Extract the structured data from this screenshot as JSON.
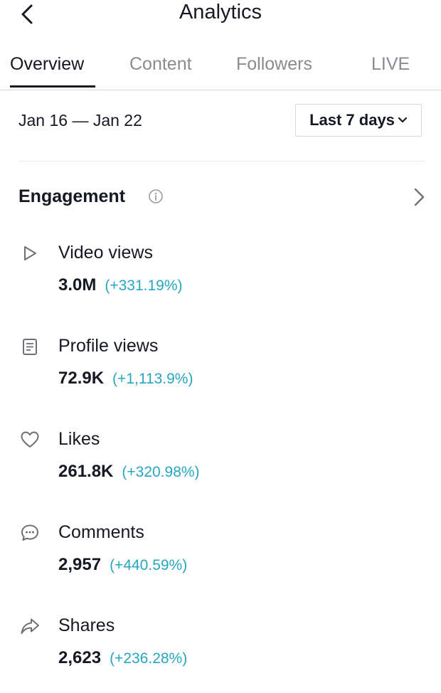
{
  "header": {
    "title": "Analytics"
  },
  "tabs": [
    {
      "label": "Overview",
      "active": true
    },
    {
      "label": "Content"
    },
    {
      "label": "Followers"
    },
    {
      "label": "LIVE"
    }
  ],
  "date_range": "Jan 16 — Jan 22",
  "range_select": {
    "label": "Last 7 days"
  },
  "section": {
    "title": "Engagement"
  },
  "metrics": [
    {
      "label": "Video views",
      "value": "3.0M",
      "change": "(+331.19%)",
      "icon": "play-icon"
    },
    {
      "label": "Profile views",
      "value": "72.9K",
      "change": "(+1,113.9%)",
      "icon": "profile-doc-icon"
    },
    {
      "label": "Likes",
      "value": "261.8K",
      "change": "(+320.98%)",
      "icon": "heart-icon"
    },
    {
      "label": "Comments",
      "value": "2,957",
      "change": "(+440.59%)",
      "icon": "comment-icon"
    },
    {
      "label": "Shares",
      "value": "2,623",
      "change": "(+236.28%)",
      "icon": "share-icon"
    }
  ],
  "colors": {
    "accent_change": "#27a6c0",
    "text": "#161823",
    "muted": "#8a8b91"
  }
}
